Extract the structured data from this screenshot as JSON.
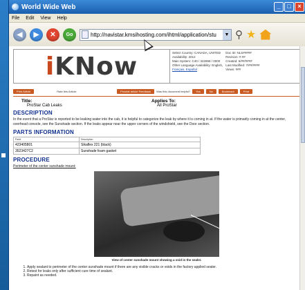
{
  "window": {
    "title": "World Wide Web"
  },
  "menu": [
    "File",
    "Edit",
    "View",
    "Help"
  ],
  "address": {
    "url": "http://navistar.kmsihosting.com/ihtml/application/stu"
  },
  "doc": {
    "logo_prefix": "i",
    "logo_rest": "KNow",
    "meta_left": [
      "Select Country: CANADA, UNITED",
      "Availability: 2012",
      "Main System: C40 / 322858 / 0000",
      "Other Language Availability: English,"
    ],
    "meta_links": "Français, Español",
    "meta_right": [
      "Doc ID: NLS#####",
      "Revision: #.##",
      "Created: 5/##/####",
      "Last Modified: 7/##/####",
      "Views: ###"
    ],
    "action_buttons": {
      "print": "Print Article",
      "email_label": "Rate this Article:",
      "feedback": "Provide article Feedback",
      "helpful_q": "Was this document helpful?",
      "yes": "Yes",
      "no": "No",
      "bookmark": "Bookmark",
      "print2": "Print"
    },
    "title_label": "Title:",
    "title_value": "ProStar Cab Leaks",
    "applies_label": "Applies To:",
    "applies_value": "All ProStar",
    "description_heading": "DESCRIPTION",
    "description": "In the event that a ProStar is reported to be leaking water into the cab, it is helpful to categorize the leak by where it is coming in at. If the water is primarily coming in at the center, overhead console, see the Sunshade section. If the leaks appear near the upper corners of the windshield, see the Door section.",
    "parts_heading": "PARTS INFORMATION",
    "parts_headers": [
      "Part#",
      "Description"
    ],
    "parts": [
      {
        "part": "423405801",
        "desc": "Sikaflex 221 (black)"
      },
      {
        "part": "3523427C2",
        "desc": "Sunshade foam gasket"
      }
    ],
    "procedure_heading": "PROCEDURE",
    "procedure_sub": "Perimeter of the center sunshade mount:",
    "photo_caption": "View of center sunshade mount showing a void in the sealer.",
    "steps": [
      "Apply sealant to perimeter of the center sunshade mount if there are any visible cracks or voids in the factory applied sealer.",
      "Retest for leaks only after sufficient cure time of sealant.",
      "Repaint as needed."
    ]
  }
}
